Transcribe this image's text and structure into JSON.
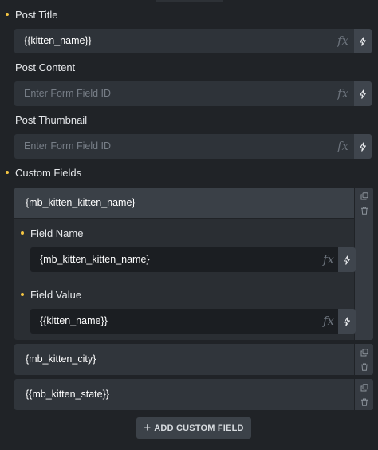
{
  "post_title": {
    "label": "Post Title",
    "value": "{{kitten_name}}"
  },
  "post_content": {
    "label": "Post Content",
    "placeholder": "Enter Form Field ID"
  },
  "post_thumbnail": {
    "label": "Post Thumbnail",
    "placeholder": "Enter Form Field ID"
  },
  "custom_fields": {
    "label": "Custom Fields",
    "items": [
      {
        "title": "{mb_kitten_kitten_name}",
        "expanded": true,
        "field_name_label": "Field Name",
        "field_name_value": "{mb_kitten_kitten_name}",
        "field_value_label": "Field Value",
        "field_value_value": "{{kitten_name}}"
      },
      {
        "title": "{mb_kitten_city}",
        "expanded": false
      },
      {
        "title": "{{mb_kitten_state}}",
        "expanded": false
      }
    ],
    "add_button_label": "ADD CUSTOM FIELD"
  },
  "fx_glyph": "fx",
  "colors": {
    "background": "#202327",
    "field": "#2e3339",
    "dot_accent": "#f5c542"
  }
}
